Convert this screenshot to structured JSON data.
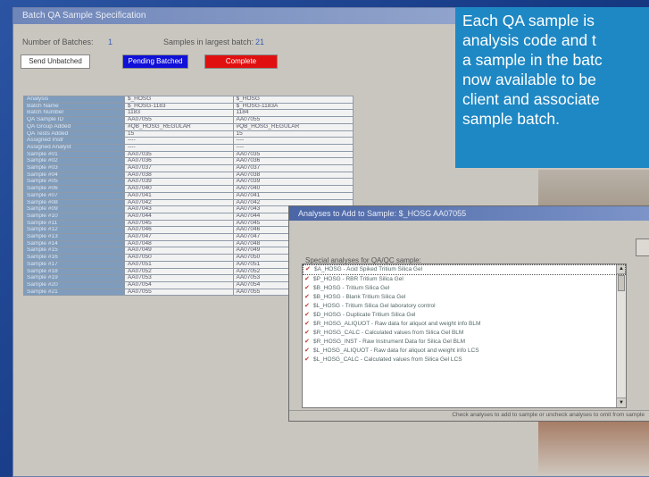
{
  "main_window": {
    "title": "Batch QA Sample Specification",
    "number_of_batches_label": "Number of Batches:",
    "number_of_batches_value": "1",
    "samples_largest_label": "Samples in largest batch:",
    "samples_largest_value": "21",
    "status_boxes": [
      {
        "label": "Send Unbatched",
        "color": "#ffffff"
      },
      {
        "label": "Pending Batched",
        "color": "#1010d8"
      },
      {
        "label": "Complete",
        "color": "#e01010"
      }
    ]
  },
  "grid": {
    "rows": [
      {
        "label": "Analysis",
        "c1": "$_HOSG",
        "c2": "$_HOSG"
      },
      {
        "label": "Batch Name",
        "c1": "$_HOSG-1183",
        "c2": "$_HOSG-1183A"
      },
      {
        "label": "Batch Number",
        "c1": "1183",
        "c2": "1184"
      },
      {
        "label": "QA Sample ID",
        "c1": "AA07055",
        "c2": "AA07055"
      },
      {
        "label": "QA Group Added",
        "c1": "#QB_HOSG_REGULAR",
        "c2": "#QB_HOSG_REGULAR"
      },
      {
        "label": "QA Tests Added",
        "c1": "15",
        "c2": "15"
      },
      {
        "label": "Assigned Instr",
        "c1": "----",
        "c2": "----"
      },
      {
        "label": "Assigned Analyst",
        "c1": "----",
        "c2": "----"
      },
      {
        "label": "Sample #01",
        "c1": "AA07035",
        "c2": "AA07035"
      },
      {
        "label": "Sample #02",
        "c1": "AA07036",
        "c2": "AA07036"
      },
      {
        "label": "Sample #03",
        "c1": "AA07037",
        "c2": "AA07037"
      },
      {
        "label": "Sample #04",
        "c1": "AA07038",
        "c2": "AA07038"
      },
      {
        "label": "Sample #05",
        "c1": "AA07039",
        "c2": "AA07039"
      },
      {
        "label": "Sample #06",
        "c1": "AA07040",
        "c2": "AA07040"
      },
      {
        "label": "Sample #07",
        "c1": "AA07041",
        "c2": "AA07041"
      },
      {
        "label": "Sample #08",
        "c1": "AA07042",
        "c2": "AA07042"
      },
      {
        "label": "Sample #09",
        "c1": "AA07043",
        "c2": "AA07043"
      },
      {
        "label": "Sample #10",
        "c1": "AA07044",
        "c2": "AA07044"
      },
      {
        "label": "Sample #11",
        "c1": "AA07045",
        "c2": "AA07045"
      },
      {
        "label": "Sample #12",
        "c1": "AA07046",
        "c2": "AA07046"
      },
      {
        "label": "Sample #13",
        "c1": "AA07047",
        "c2": "AA07047"
      },
      {
        "label": "Sample #14",
        "c1": "AA07048",
        "c2": "AA07048"
      },
      {
        "label": "Sample #15",
        "c1": "AA07049",
        "c2": "AA07049"
      },
      {
        "label": "Sample #16",
        "c1": "AA07050",
        "c2": "AA07050"
      },
      {
        "label": "Sample #17",
        "c1": "AA07051",
        "c2": "AA07051"
      },
      {
        "label": "Sample #18",
        "c1": "AA07052",
        "c2": "AA07052"
      },
      {
        "label": "Sample #19",
        "c1": "AA07053",
        "c2": "AA07053"
      },
      {
        "label": "Sample #20",
        "c1": "AA07054",
        "c2": "AA07054"
      },
      {
        "label": "Sample #21",
        "c1": "AA07055",
        "c2": "AA07055"
      }
    ]
  },
  "callout": {
    "lines": [
      "Each QA sample is",
      "analysis code and t",
      "a sample in the batc",
      "now available to be",
      "client and associate",
      "sample batch."
    ]
  },
  "dialog": {
    "title": "Analyses to Add to Sample: $_HOSG  AA07055",
    "list_label": "Special analyses for QA/QC sample:",
    "items": [
      "$A_HOSG - Acid Spiked Tritium Silica Gel",
      "$P_HOSG - RBR Tritium Silica Gel",
      "$B_HOSG - Tritium Silica Gel",
      "$B_HOSG - Blank Tritium Silica Gel",
      "$L_HOSG - Tritium Silica Gel laboratory control",
      "$D_HOSG - Duplicate Tritium Silica Gel",
      "$R_HOSG_ALIQUOT - Raw data for aliquot and weight info BLM",
      "$R_HOSG_CALC - Calculated values from Silica Gel BLM",
      "$R_HOSG_INST - Raw Instrument Data for Silica Gel BLM",
      "$L_HOSG_ALIQUOT - Raw data for aliquot and weight info LCS",
      "$L_HOSG_CALC - Calculated values from Silica Gel LCS"
    ],
    "footer": "Check analyses to add to sample or uncheck analyses to omit from sample"
  }
}
